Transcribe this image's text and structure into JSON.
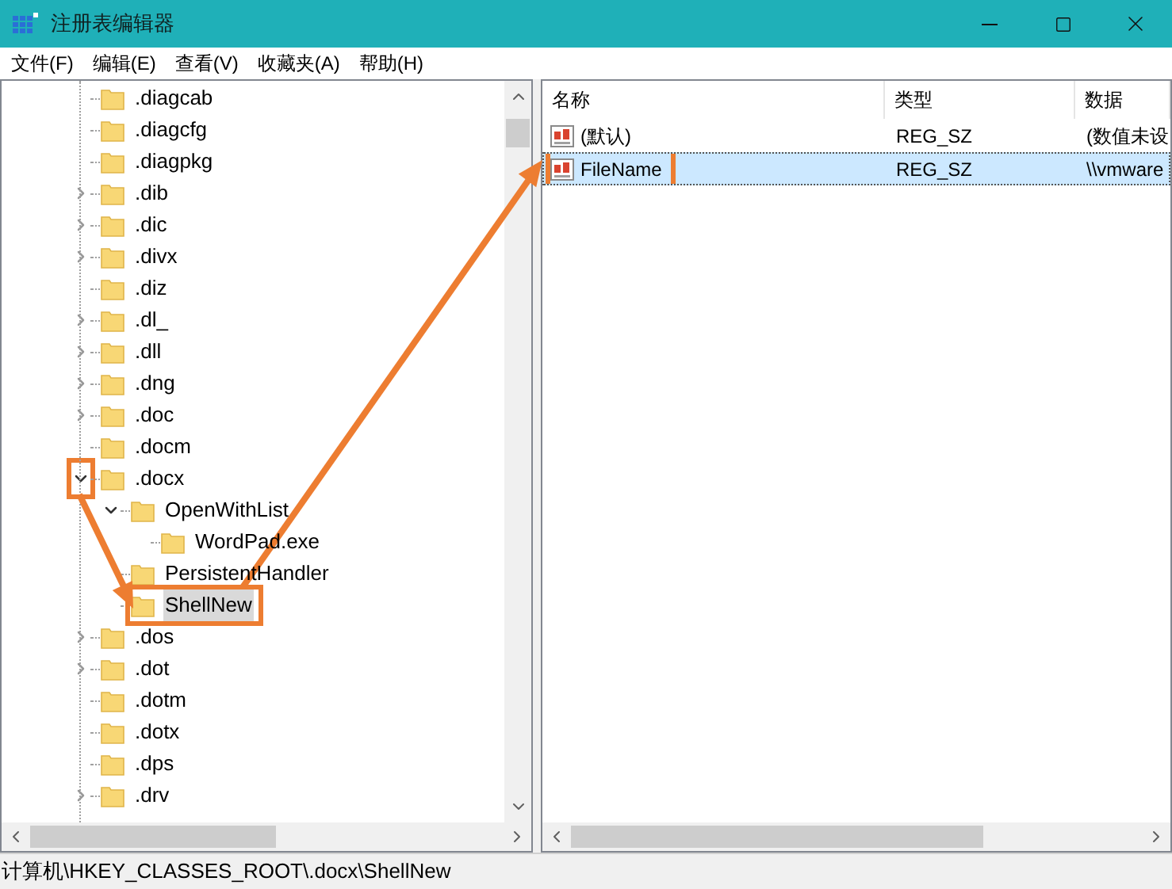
{
  "window": {
    "title": "注册表编辑器"
  },
  "menu": [
    "文件(F)",
    "编辑(E)",
    "查看(V)",
    "收藏夹(A)",
    "帮助(H)"
  ],
  "tree": [
    {
      "label": ".diagcab",
      "expandable": false,
      "selected": false,
      "highlighted": false
    },
    {
      "label": ".diagcfg",
      "expandable": false,
      "selected": false,
      "highlighted": false
    },
    {
      "label": ".diagpkg",
      "expandable": false,
      "selected": false,
      "highlighted": false
    },
    {
      "label": ".dib",
      "expandable": true,
      "expanded": false,
      "selected": false,
      "highlighted": false
    },
    {
      "label": ".dic",
      "expandable": true,
      "expanded": false,
      "selected": false,
      "highlighted": false
    },
    {
      "label": ".divx",
      "expandable": true,
      "expanded": false,
      "selected": false,
      "highlighted": false
    },
    {
      "label": ".diz",
      "expandable": false,
      "selected": false,
      "highlighted": false
    },
    {
      "label": ".dl_",
      "expandable": true,
      "expanded": false,
      "selected": false,
      "highlighted": false
    },
    {
      "label": ".dll",
      "expandable": true,
      "expanded": false,
      "selected": false,
      "highlighted": false
    },
    {
      "label": ".dng",
      "expandable": true,
      "expanded": false,
      "selected": false,
      "highlighted": false
    },
    {
      "label": ".doc",
      "expandable": true,
      "expanded": false,
      "selected": false,
      "highlighted": false
    },
    {
      "label": ".docm",
      "expandable": false,
      "selected": false,
      "highlighted": false
    },
    {
      "label": ".docx",
      "expandable": true,
      "expanded": true,
      "selected": false,
      "highlighted": false,
      "expander_highlighted": true,
      "children": [
        {
          "label": "OpenWithList",
          "expandable": true,
          "expanded": true,
          "selected": false,
          "highlighted": false,
          "children": [
            {
              "label": "WordPad.exe",
              "expandable": false,
              "selected": false,
              "highlighted": false
            }
          ]
        },
        {
          "label": "PersistentHandler",
          "expandable": false,
          "selected": false,
          "highlighted": false
        },
        {
          "label": "ShellNew",
          "expandable": false,
          "selected": true,
          "highlighted": true
        }
      ]
    },
    {
      "label": ".dos",
      "expandable": true,
      "expanded": false,
      "selected": false,
      "highlighted": false
    },
    {
      "label": ".dot",
      "expandable": true,
      "expanded": false,
      "selected": false,
      "highlighted": false
    },
    {
      "label": ".dotm",
      "expandable": false,
      "selected": false,
      "highlighted": false
    },
    {
      "label": ".dotx",
      "expandable": false,
      "selected": false,
      "highlighted": false
    },
    {
      "label": ".dps",
      "expandable": false,
      "selected": false,
      "highlighted": false
    },
    {
      "label": ".drv",
      "expandable": true,
      "expanded": false,
      "selected": false,
      "highlighted": false
    }
  ],
  "values": {
    "columns": [
      "名称",
      "类型",
      "数据"
    ],
    "rows": [
      {
        "name": "(默认)",
        "type": "REG_SZ",
        "data": "(数值未设",
        "selected": false,
        "highlighted": false
      },
      {
        "name": "FileName",
        "type": "REG_SZ",
        "data": "\\\\vmware",
        "selected": true,
        "highlighted": true
      }
    ]
  },
  "status_bar": "计算机\\HKEY_CLASSES_ROOT\\.docx\\ShellNew"
}
